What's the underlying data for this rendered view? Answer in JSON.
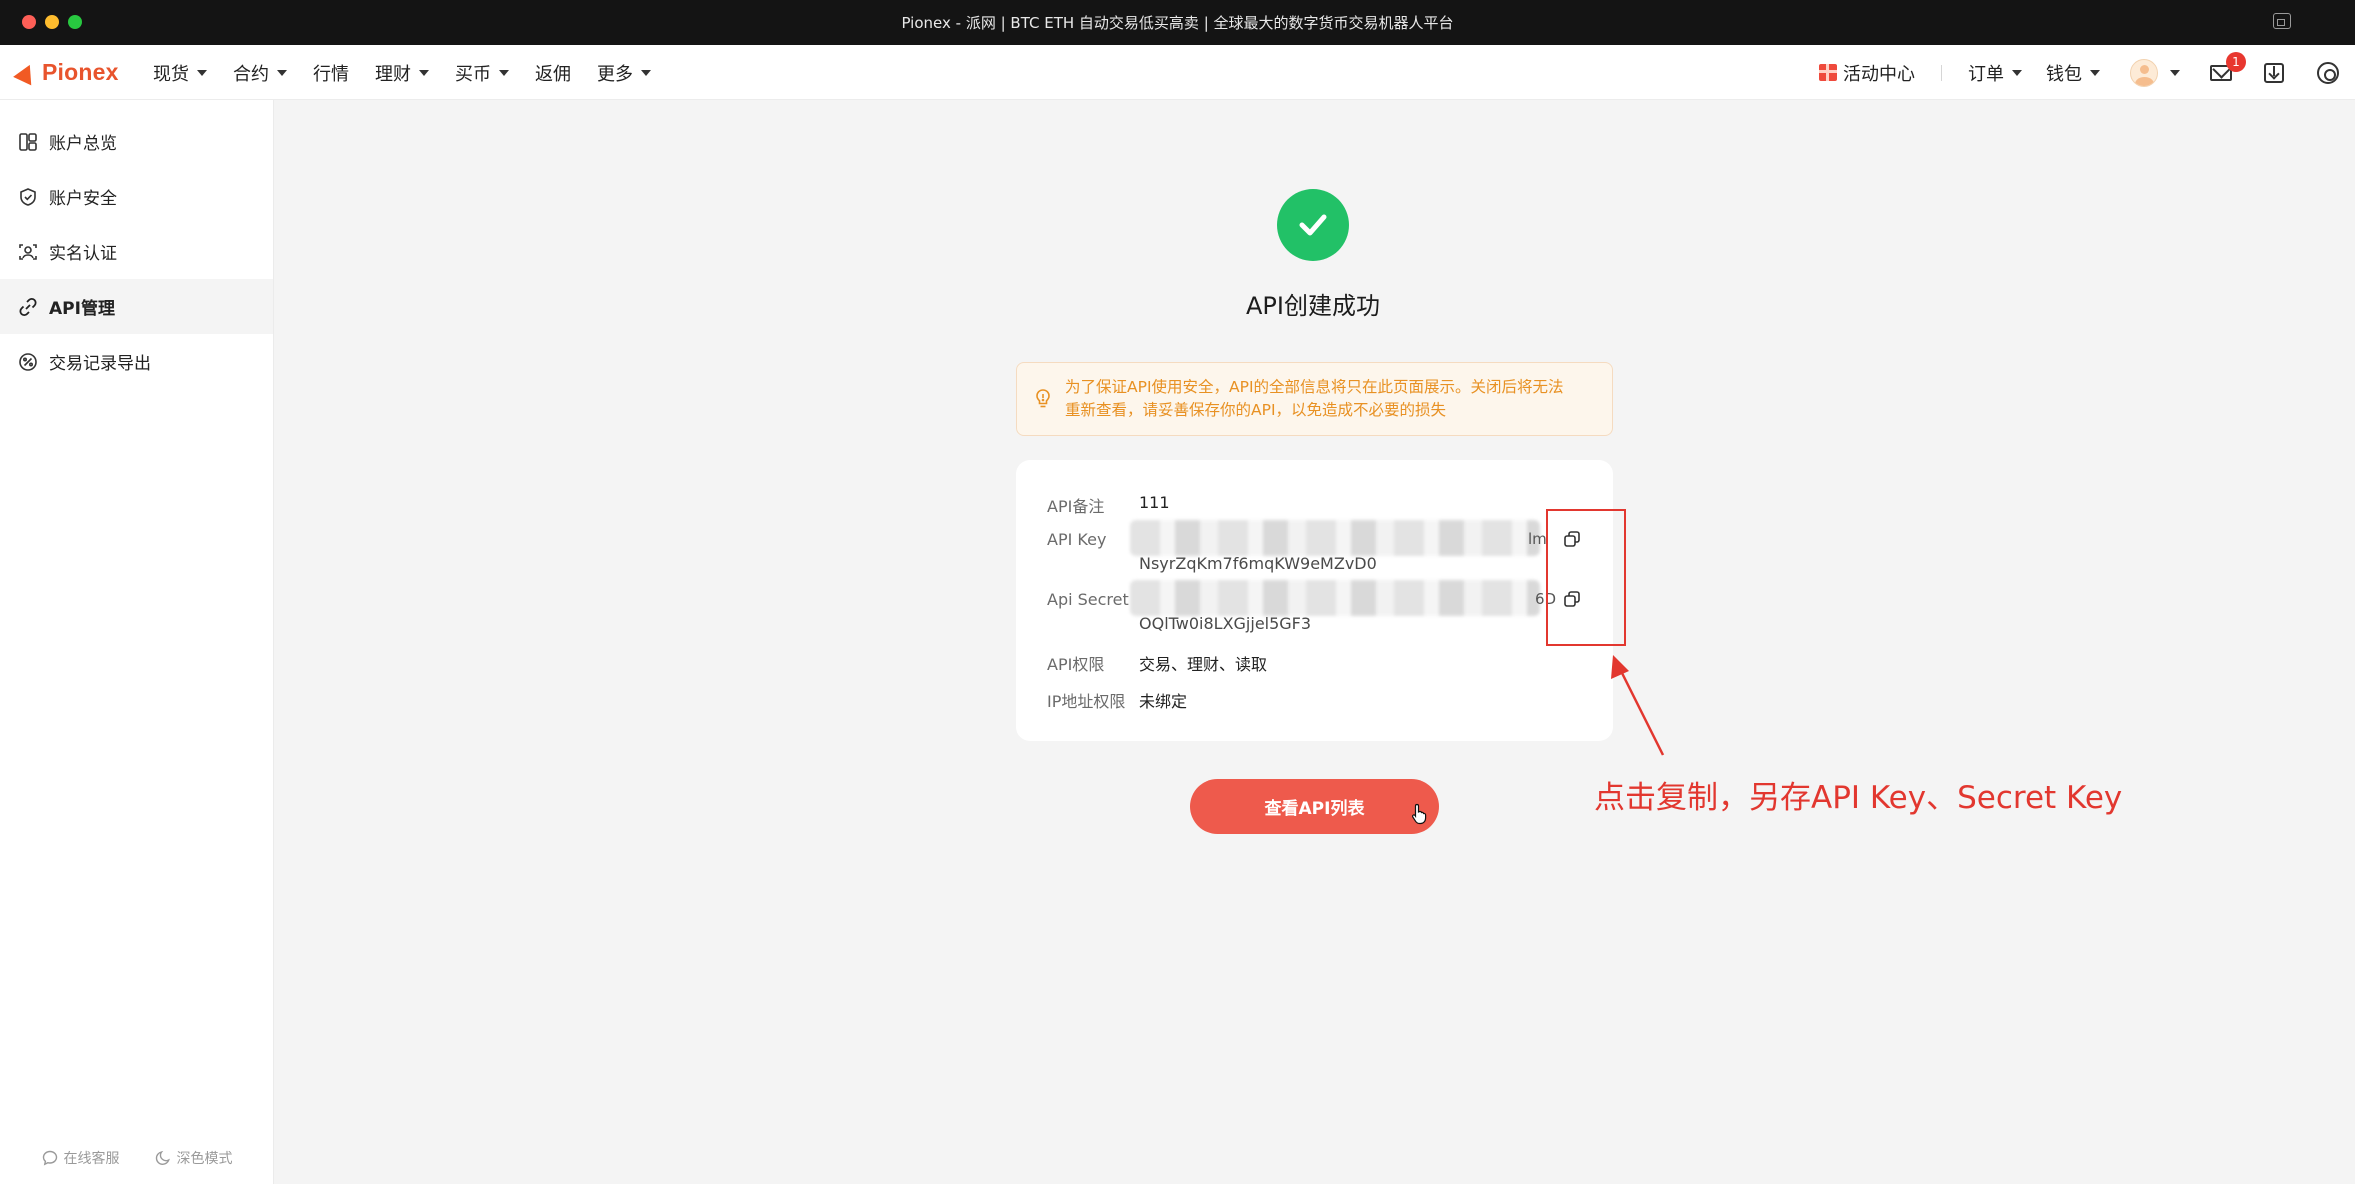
{
  "window": {
    "title": "Pionex - 派网 | BTC ETH 自动交易低买高卖 | 全球最大的数字货币交易机器人平台"
  },
  "navbar": {
    "logo_text": "Pionex",
    "menu": [
      {
        "label": "现货",
        "dropdown": true
      },
      {
        "label": "合约",
        "dropdown": true
      },
      {
        "label": "行情",
        "dropdown": false
      },
      {
        "label": "理财",
        "dropdown": true
      },
      {
        "label": "买币",
        "dropdown": true
      },
      {
        "label": "返佣",
        "dropdown": false
      },
      {
        "label": "更多",
        "dropdown": true
      }
    ],
    "activity_center": "活动中心",
    "orders": "订单",
    "wallet": "钱包",
    "notification_count": "1"
  },
  "sidebar": {
    "items": [
      {
        "label": "账户总览",
        "icon": "dashboard-icon",
        "active": false
      },
      {
        "label": "账户安全",
        "icon": "shield-icon",
        "active": false
      },
      {
        "label": "实名认证",
        "icon": "user-scan-icon",
        "active": false
      },
      {
        "label": "API管理",
        "icon": "link-icon",
        "active": true
      },
      {
        "label": "交易记录导出",
        "icon": "percent-icon",
        "active": false
      }
    ],
    "footer": {
      "support": "在线客服",
      "dark_mode": "深色模式"
    }
  },
  "main": {
    "success_title": "API创建成功",
    "warning_line1": "为了保证API使用安全，API的全部信息将只在此页面展示。关闭后将无法",
    "warning_line2": "重新查看，请妥善保存你的API，以免造成不必要的损失",
    "fields": {
      "note_label": "API备注",
      "note_value": "111",
      "key_label": "API Key",
      "key_visible_suffix": "lm",
      "key_line2": "NsyrZqKm7f6mqKW9eMZvD0",
      "secret_label": "Api Secret",
      "secret_visible_suffix": "6D",
      "secret_line2": "OQlTw0i8LXGjjel5GF3",
      "permission_label": "API权限",
      "permission_value": "交易、理财、读取",
      "ip_label": "IP地址权限",
      "ip_value": "未绑定"
    },
    "view_list_button": "查看API列表"
  },
  "annotation": {
    "text": "点击复制，另存API Key、Secret Key",
    "color": "#e2372f"
  },
  "colors": {
    "brand": "#e8542d",
    "success": "#22c167",
    "warning_text": "#e89123",
    "cta": "#ee5a4c"
  }
}
